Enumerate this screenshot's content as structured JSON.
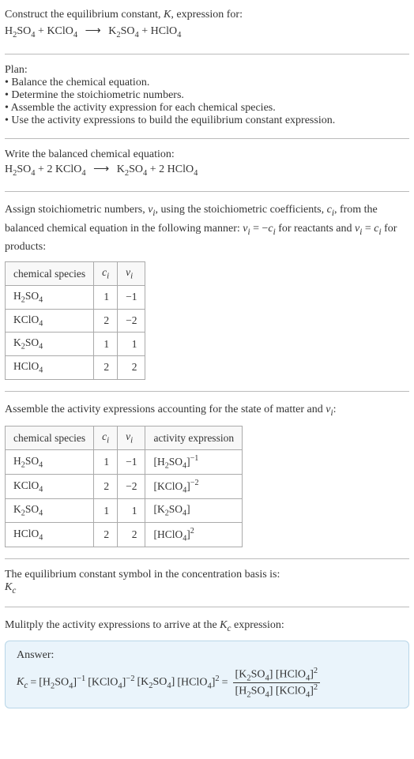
{
  "intro": {
    "line1_a": "Construct the equilibrium constant, ",
    "line1_k": "K",
    "line1_b": ", expression for:",
    "eq_lhs1": "H",
    "eq_lhs1_sub": "2",
    "eq_lhs1b": "SO",
    "eq_lhs1_sub2": "4",
    "plus1": " + ",
    "eq_lhs2": "KClO",
    "eq_lhs2_sub": "4",
    "arrow": "⟶",
    "eq_rhs1": "K",
    "eq_rhs1_sub": "2",
    "eq_rhs1b": "SO",
    "eq_rhs1_sub2": "4",
    "plus2": " + ",
    "eq_rhs2": "HClO",
    "eq_rhs2_sub": "4"
  },
  "plan": {
    "title": "Plan:",
    "b1": "• Balance the chemical equation.",
    "b2": "• Determine the stoichiometric numbers.",
    "b3": "• Assemble the activity expression for each chemical species.",
    "b4": "• Use the activity expressions to build the equilibrium constant expression."
  },
  "balanced": {
    "title": "Write the balanced chemical equation:",
    "coef1": "",
    "sp1a": "H",
    "sp1b": "SO",
    "plus1": " + ",
    "coef2": "2 ",
    "sp2": "KClO",
    "arrow": "⟶",
    "coef3": "",
    "sp3a": "K",
    "sp3b": "SO",
    "plus2": " + ",
    "coef4": "2 ",
    "sp4": "HClO"
  },
  "stoich": {
    "para_a": "Assign stoichiometric numbers, ",
    "nu": "ν",
    "sub_i": "i",
    "para_b": ", using the stoichiometric coefficients, ",
    "ci": "c",
    "para_c": ", from the balanced chemical equation in the following manner: ",
    "rel1a": "ν",
    "rel1b": " = −",
    "rel1c": "c",
    "para_d": " for reactants and ",
    "rel2a": "ν",
    "rel2b": " = ",
    "rel2c": "c",
    "para_e": " for products:"
  },
  "table1": {
    "h1": "chemical species",
    "h2": "c",
    "h2sub": "i",
    "h3": "ν",
    "h3sub": "i",
    "r1c1a": "H",
    "r1c1b": "SO",
    "r1c2": "1",
    "r1c3": "−1",
    "r2c1": "KClO",
    "r2c2": "2",
    "r2c3": "−2",
    "r3c1a": "K",
    "r3c1b": "SO",
    "r3c2": "1",
    "r3c3": "1",
    "r4c1": "HClO",
    "r4c2": "2",
    "r4c3": "2"
  },
  "activity": {
    "title_a": "Assemble the activity expressions accounting for the state of matter and ",
    "nu": "ν",
    "sub_i": "i",
    "title_b": ":"
  },
  "table2": {
    "h1": "chemical species",
    "h2": "c",
    "h2sub": "i",
    "h3": "ν",
    "h3sub": "i",
    "h4": "activity expression",
    "r1c1a": "H",
    "r1c1b": "SO",
    "r1c2": "1",
    "r1c3": "−1",
    "r1c4_exp": "−1",
    "r2c1": "KClO",
    "r2c2": "2",
    "r2c3": "−2",
    "r2c4_exp": "−2",
    "r3c1a": "K",
    "r3c1b": "SO",
    "r3c2": "1",
    "r3c3": "1",
    "r4c1": "HClO",
    "r4c2": "2",
    "r4c3": "2",
    "r4c4_exp": "2"
  },
  "kc_intro": {
    "line1": "The equilibrium constant symbol in the concentration basis is:",
    "K": "K",
    "c": "c"
  },
  "mult": {
    "line_a": "Mulitply the activity expressions to arrive at the ",
    "K": "K",
    "c": "c",
    "line_b": " expression:"
  },
  "answer": {
    "label": "Answer:",
    "K": "K",
    "c": "c",
    "eq": " = ",
    "t1_exp": "−1",
    "t2_exp": "−2",
    "t4_exp": "2",
    "eq2": " = ",
    "num_t2_exp": "2",
    "den_t2_exp": "2"
  },
  "chart_data": {
    "type": "table",
    "title": "Stoichiometric numbers",
    "columns": [
      "chemical species",
      "c_i",
      "ν_i"
    ],
    "rows": [
      [
        "H2SO4",
        1,
        -1
      ],
      [
        "KClO4",
        2,
        -2
      ],
      [
        "K2SO4",
        1,
        1
      ],
      [
        "HClO4",
        2,
        2
      ]
    ]
  }
}
